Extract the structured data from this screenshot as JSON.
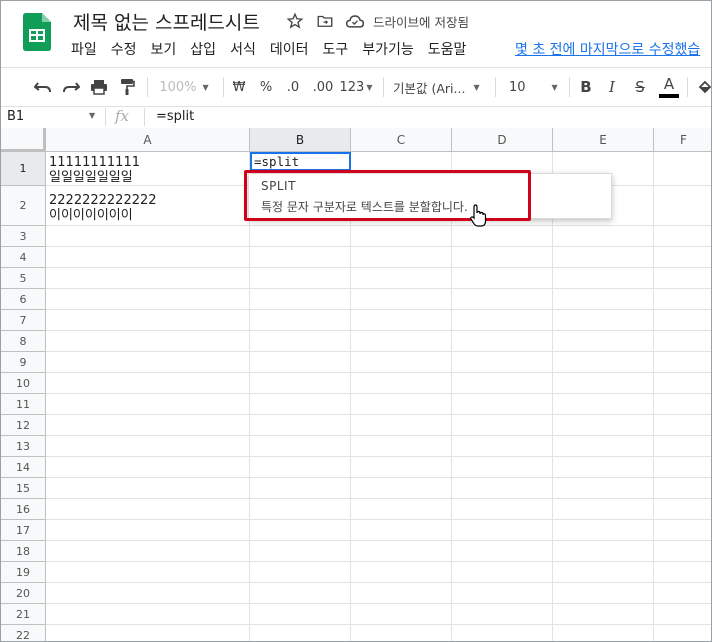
{
  "header": {
    "doc_title": "제목 없는 스프레드시트",
    "drive_status": "드라이브에 저장됨",
    "last_edit": "몇 초 전에 마지막으로 수정했습"
  },
  "menu": [
    "파일",
    "수정",
    "보기",
    "삽입",
    "서식",
    "데이터",
    "도구",
    "부가기능",
    "도움말"
  ],
  "toolbar": {
    "zoom": "100%",
    "currency": "₩",
    "percent": "%",
    "decimal_decrease": ".0",
    "decimal_increase": ".00",
    "number_format": "123",
    "font_family": "기본값 (Ari...",
    "font_size": "10",
    "bold": "B",
    "italic": "I",
    "strike": "S",
    "text_color": "A"
  },
  "formula_bar": {
    "name_box": "B1",
    "fx_label": "fx",
    "formula": "=split"
  },
  "columns": [
    "A",
    "B",
    "C",
    "D",
    "E",
    "F"
  ],
  "rows": [
    "1",
    "2",
    "3",
    "4",
    "5",
    "6",
    "7",
    "8",
    "9",
    "10",
    "11",
    "12",
    "13",
    "14",
    "15",
    "16",
    "17",
    "18",
    "19",
    "20",
    "21",
    "22"
  ],
  "cells": {
    "A1_line1": "11111111111",
    "A1_line2": "일일일일일일일",
    "A2_line1": "2222222222222",
    "A2_line2": "이이이이이이이",
    "B1_editing": "=split"
  },
  "autocomplete": {
    "function_name": "SPLIT",
    "description": "특정 문자 구분자로 텍스트를 분할합니다."
  },
  "colors": {
    "accent": "#1a73e8",
    "highlight_box": "#d0021b",
    "sheets_green": "#0f9d58"
  }
}
